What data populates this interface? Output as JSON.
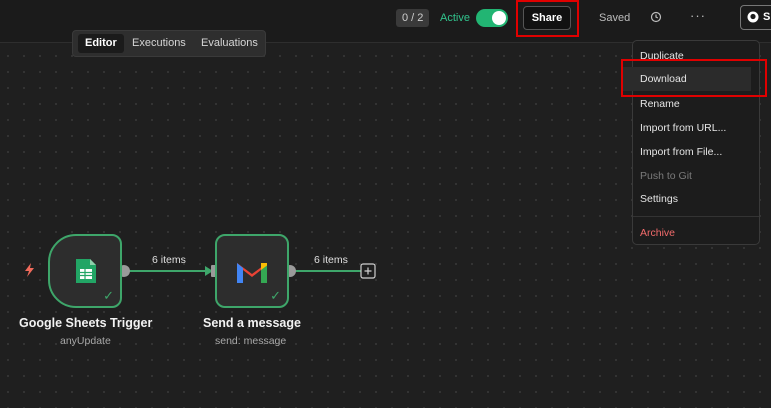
{
  "header": {
    "counter": "0 / 2",
    "active_label": "Active",
    "share_label": "Share",
    "saved_label": "Saved",
    "more_label": "···",
    "github_label": "S"
  },
  "tabs": [
    "Editor",
    "Executions",
    "Evaluations"
  ],
  "menu": {
    "items": [
      "Duplicate",
      "Download",
      "Rename",
      "Import from URL...",
      "Import from File...",
      "Push to Git",
      "Settings",
      "Archive"
    ]
  },
  "nodes": [
    {
      "title": "Google Sheets Trigger",
      "subtitle": "anyUpdate"
    },
    {
      "title": "Send a message",
      "subtitle": "send: message"
    }
  ],
  "connections": [
    "6 items",
    "6 items"
  ],
  "colors": {
    "accent": "#3ea66a",
    "toggle": "#22b573",
    "danger": "#f26b6b",
    "highlight": "#e00000"
  }
}
